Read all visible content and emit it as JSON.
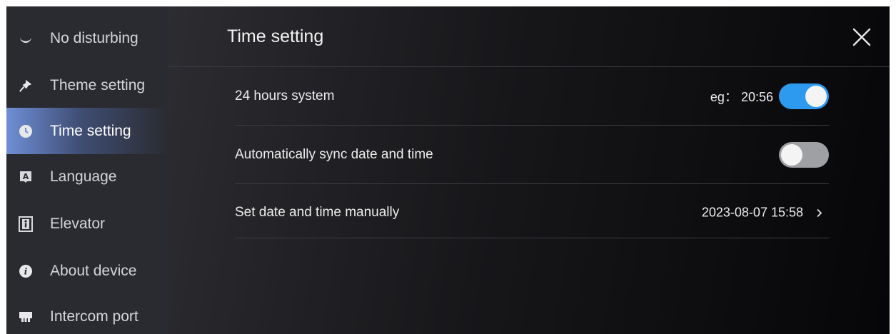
{
  "sidebar": {
    "items": [
      {
        "label": "No disturbing",
        "icon": "moon-icon"
      },
      {
        "label": "Theme setting",
        "icon": "pin-icon"
      },
      {
        "label": "Time setting",
        "icon": "clock-icon",
        "active": true
      },
      {
        "label": "Language",
        "icon": "language-icon"
      },
      {
        "label": "Elevator",
        "icon": "elevator-icon"
      },
      {
        "label": "About device",
        "icon": "info-icon"
      },
      {
        "label": "Intercom port",
        "icon": "port-icon"
      }
    ]
  },
  "header": {
    "title": "Time setting",
    "close_icon": "close-icon"
  },
  "settings": {
    "hours24": {
      "label": "24 hours system",
      "example": "eg： 20:56",
      "enabled": true
    },
    "autosync": {
      "label": "Automatically sync date and time",
      "enabled": false
    },
    "manual": {
      "label": "Set date and time manually",
      "value": "2023-08-07 15:58"
    }
  },
  "colors": {
    "accent": "#2d9af0",
    "sidebar_bg": "#2a2b30",
    "toggle_off": "#9fa0a4"
  }
}
